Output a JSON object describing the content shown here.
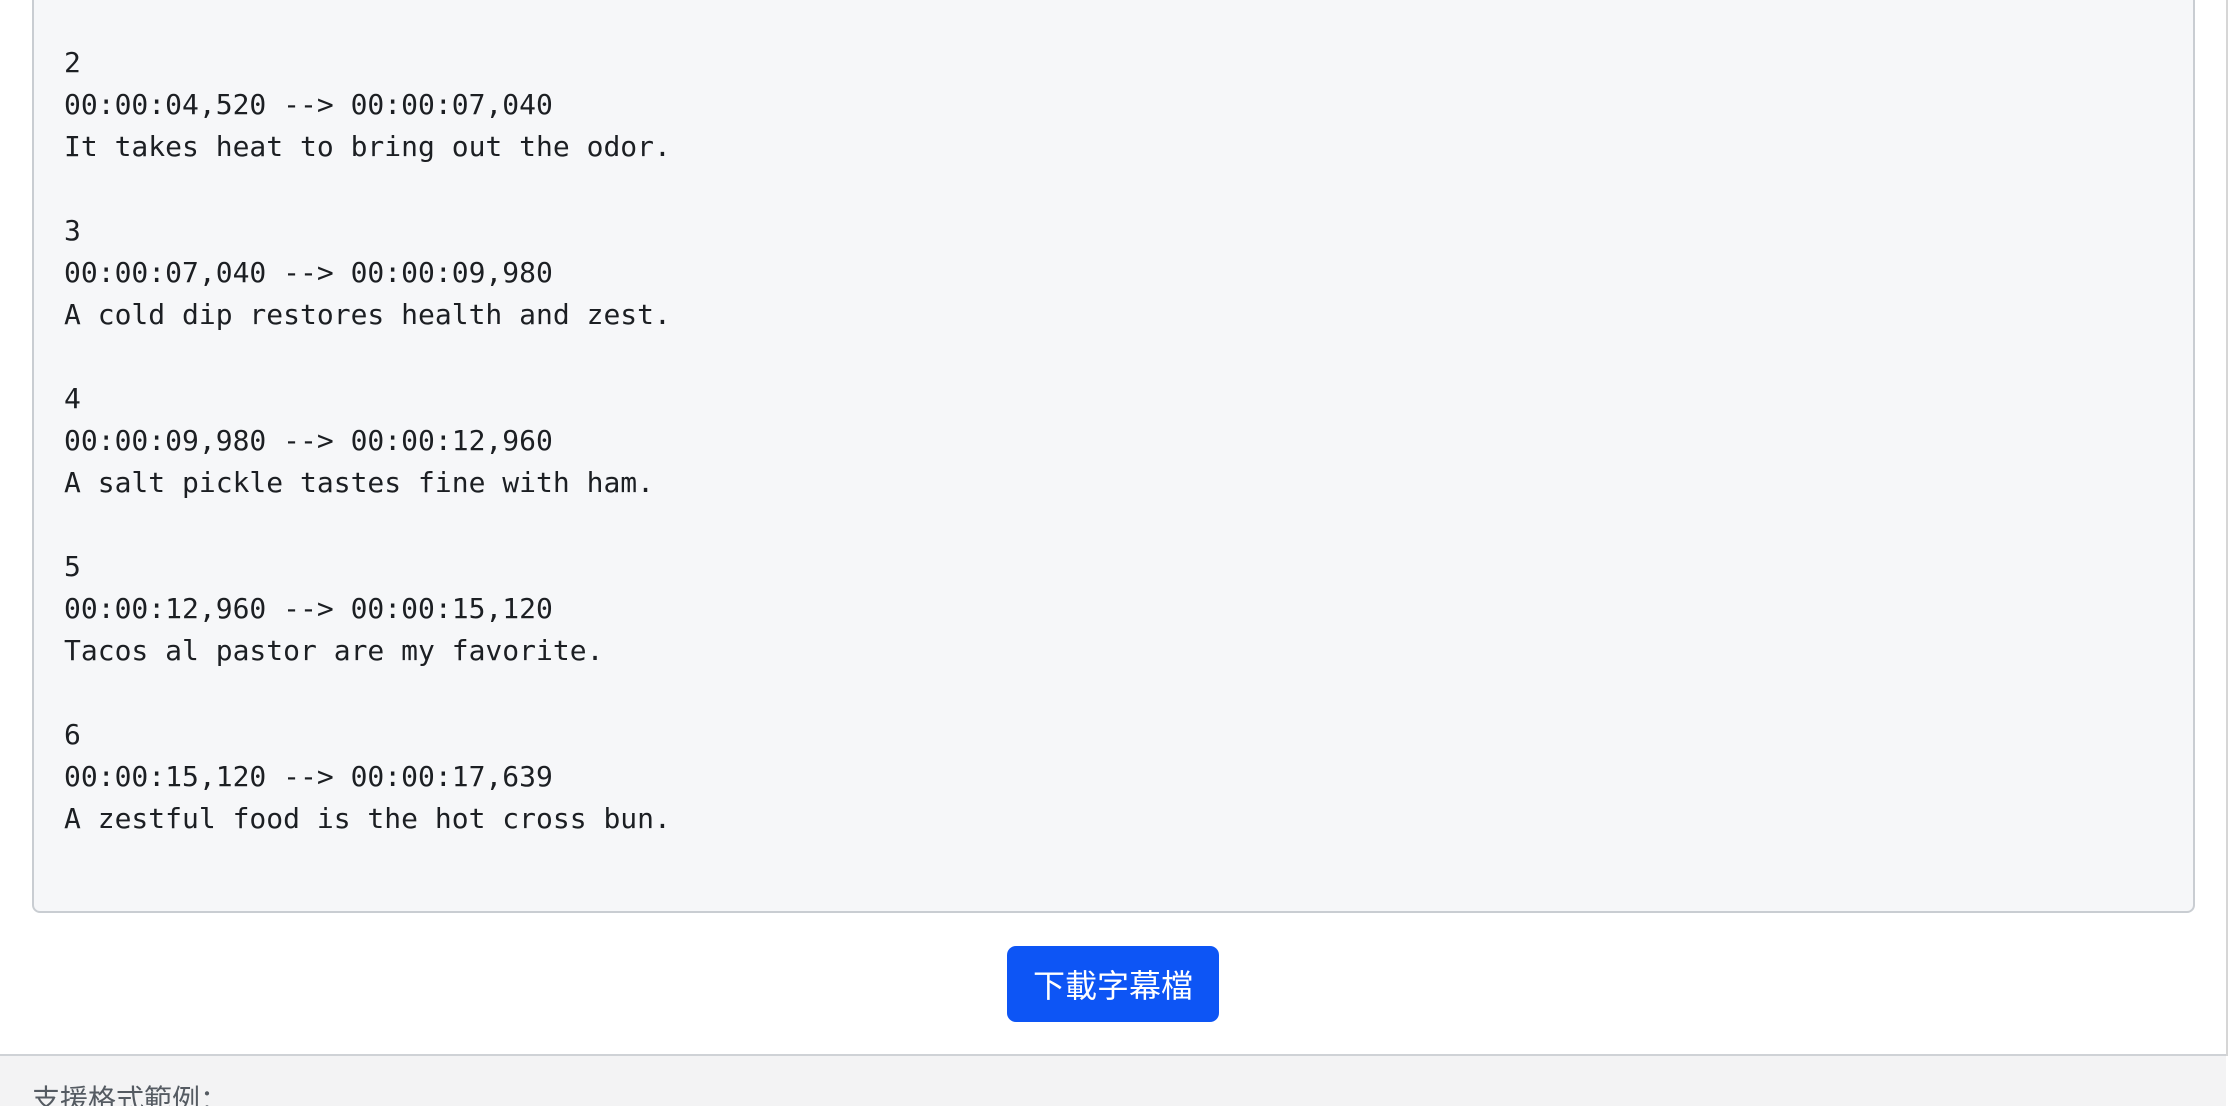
{
  "subtitle_output": {
    "cues": [
      {
        "index": "2",
        "timing": "00:00:04,520 --> 00:00:07,040",
        "text": "It takes heat to bring out the odor."
      },
      {
        "index": "3",
        "timing": "00:00:07,040 --> 00:00:09,980",
        "text": "A cold dip restores health and zest."
      },
      {
        "index": "4",
        "timing": "00:00:09,980 --> 00:00:12,960",
        "text": "A salt pickle tastes fine with ham."
      },
      {
        "index": "5",
        "timing": "00:00:12,960 --> 00:00:15,120",
        "text": "Tacos al pastor are my favorite."
      },
      {
        "index": "6",
        "timing": "00:00:15,120 --> 00:00:17,639",
        "text": "A zestful food is the hot cross bun."
      }
    ]
  },
  "actions": {
    "download_label": "下載字幕檔"
  },
  "formats": {
    "heading": "支援格式範例："
  },
  "colors": {
    "button": "#0d55f5",
    "output_background": "#f6f7f9",
    "output_border": "#c9cdd2",
    "section_background": "#f3f3f4"
  }
}
